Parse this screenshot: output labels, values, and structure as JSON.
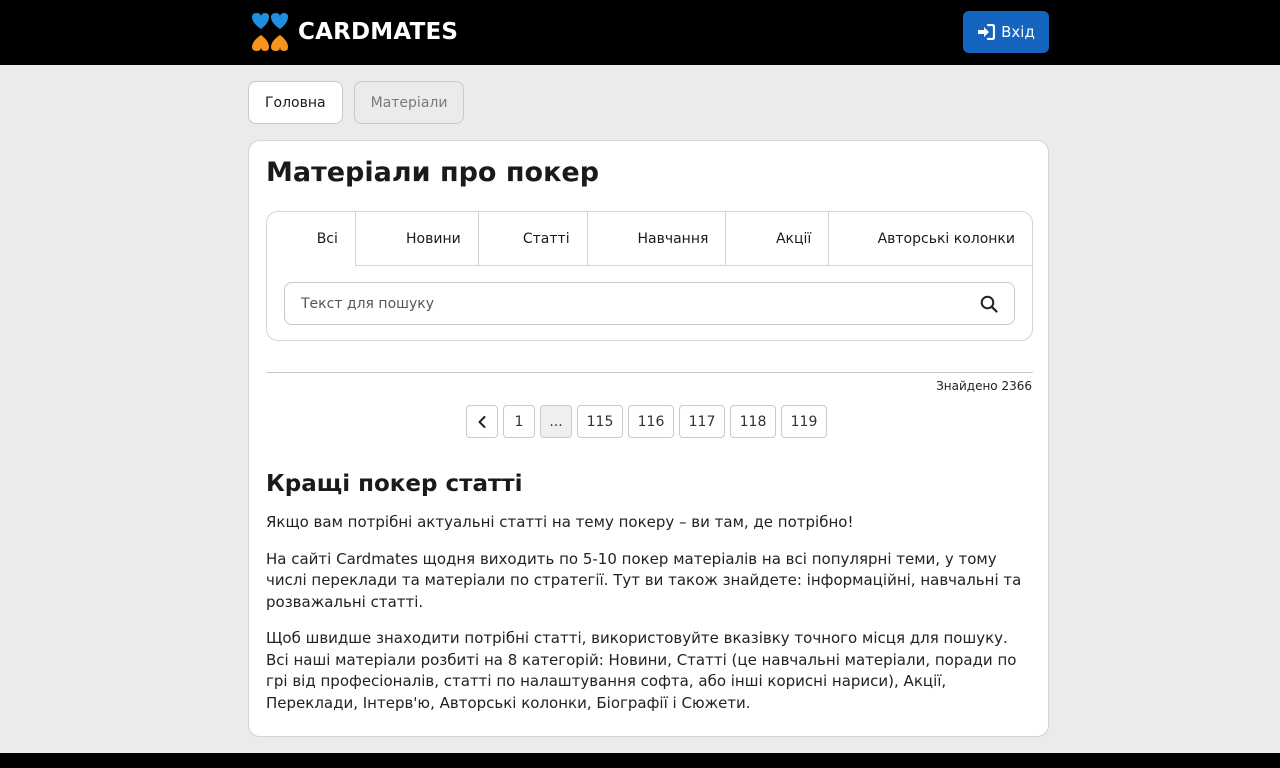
{
  "header": {
    "logo_text": "CARDMATES",
    "login_label": "Вхід",
    "brand_colors": {
      "orange": "#f7941d",
      "blue": "#1f8fe0",
      "button": "#1565c0"
    }
  },
  "breadcrumbs": [
    {
      "label": "Головна"
    },
    {
      "label": "Матеріали"
    }
  ],
  "main": {
    "title": "Матеріали про покер",
    "tabs": [
      {
        "label": "Всі",
        "active": true
      },
      {
        "label": "Новини"
      },
      {
        "label": "Статті"
      },
      {
        "label": "Навчання"
      },
      {
        "label": "Акції"
      },
      {
        "label": "Авторські колонки"
      }
    ],
    "search": {
      "placeholder": "Текст для пошуку",
      "icon": "search-icon"
    },
    "found_text": "Знайдено 2366",
    "pagination": {
      "prev_icon": "chevron-left-icon",
      "pages": [
        "1",
        "...",
        "115",
        "116",
        "117",
        "118",
        "119"
      ]
    }
  },
  "article": {
    "heading": "Кращі покер статті",
    "paragraphs": [
      "Якщо вам потрібні актуальні статті на тему покеру – ви там, де потрібно!",
      "На сайті Cardmates щодня виходить по 5-10 покер матеріалів на всі популярні теми, у тому числі переклади та матеріали по стратегії. Тут ви також знайдете: інформаційні, навчальні та розважальні статті.",
      "Щоб швидше знаходити потрібні статті, використовуйте вказівку точного місця для пошуку. Всі наші матеріали розбиті на 8 категорій: Новини, Статті (це навчальні матеріали, поради по грі від професіоналів, статті по налаштування софта, або інші корисні нариси), Акції, Переклади, Інтерв'ю, Авторські колонки, Біографії і Сюжети."
    ]
  }
}
